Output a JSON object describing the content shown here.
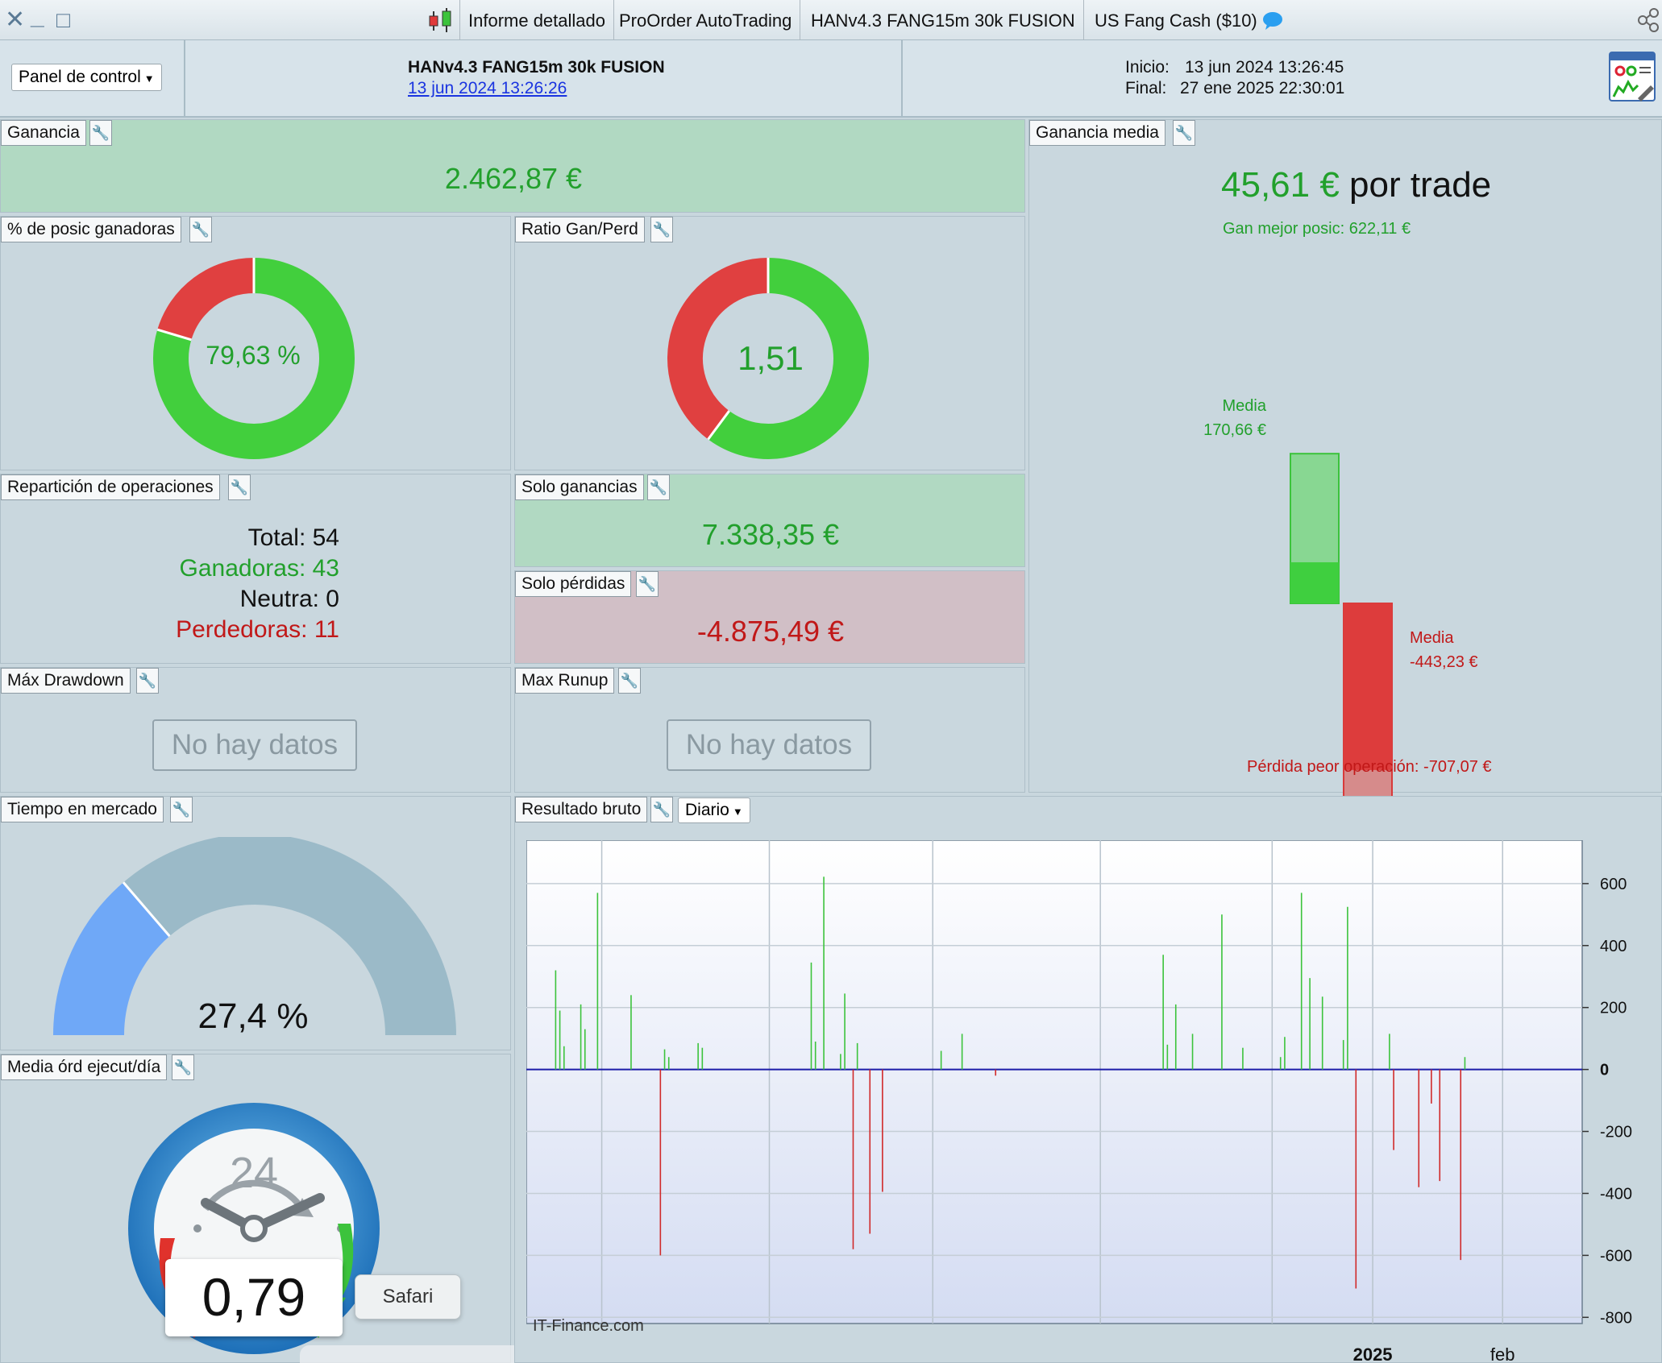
{
  "window": {
    "close_glyph": "✕",
    "minimize_glyph": "_",
    "maximize_glyph": "□",
    "tabs": [
      {
        "label": "Informe detallado",
        "icon": "candlestick-icon"
      },
      {
        "label": "ProOrder AutoTrading"
      },
      {
        "label": "HANv4.3 FANG15m 30k FUSION"
      },
      {
        "label": "US Fang Cash ($10)",
        "icon": "chat-bubble-icon"
      }
    ]
  },
  "header": {
    "panel_select": "Panel de control",
    "strategy_name": "HANv4.3 FANG15m 30k FUSION",
    "strategy_date": "13 jun 2024 13:26:26",
    "inicio_label": "Inicio:",
    "inicio_value": "13 jun 2024 13:26:45",
    "final_label": "Final:",
    "final_value": "27 ene 2025 22:30:01"
  },
  "ganancia": {
    "title": "Ganancia",
    "value": "2.462,87 €"
  },
  "pct_ganadoras": {
    "title": "% de posic ganadoras",
    "value": "79,63 %",
    "fraction": 0.7963
  },
  "ratio": {
    "title": "Ratio Gan/Perd",
    "value": "1,51",
    "fraction": 0.6016
  },
  "reparticion": {
    "title": "Repartición de operaciones",
    "total": "Total: 54",
    "ganadoras": "Ganadoras: 43",
    "neutra": "Neutra: 0",
    "perdedoras": "Perdedoras: 11"
  },
  "solo_ganancias": {
    "title": "Solo ganancias",
    "value": "7.338,35 €"
  },
  "solo_perdidas": {
    "title": "Solo pérdidas",
    "value": "-4.875,49 €"
  },
  "max_drawdown": {
    "title": "Máx Drawdown",
    "value": "No hay datos"
  },
  "max_runup": {
    "title": "Max Runup",
    "value": "No hay datos"
  },
  "ganancia_media": {
    "title": "Ganancia media",
    "value": "45,61 €",
    "suffix": "por trade",
    "best_label": "Gan mejor posic: 622,11 €",
    "win_media_label": "Media",
    "win_media_value": "170,66 €",
    "loss_media_label": "Media",
    "loss_media_value": "-443,23 €",
    "worst_label": "Pérdida peor operación: -707,07 €",
    "best_win": 622.11,
    "avg_win": 170.66,
    "avg_loss": -443.23,
    "worst_loss": -707.07
  },
  "tiempo_mercado": {
    "title": "Tiempo en mercado",
    "value": "27,4 %",
    "fraction": 0.274
  },
  "media_ordenes": {
    "title": "Media órd ejecut/día",
    "value": "0,79",
    "clock_label": "24"
  },
  "resultado_bruto": {
    "title": "Resultado bruto",
    "period": "Diario",
    "watermark": "IT-Finance.com"
  },
  "tooltip": {
    "label": "Safari"
  },
  "colors": {
    "green": "#22a02c",
    "red": "#c11818",
    "donut_green": "#42cf3d",
    "donut_red": "#e04040"
  },
  "chart_data": {
    "type": "bar",
    "title": "",
    "ylim": [
      -820,
      740
    ],
    "yticks": [
      600,
      400,
      200,
      0,
      -200,
      -400,
      -600,
      -800
    ],
    "ytick_labels": [
      "600",
      "400",
      "200",
      "0",
      "-200",
      "-400",
      "-600",
      "-800"
    ],
    "x_range": [
      "2024-06-13",
      "2025-02-20"
    ],
    "xtick_labels": [
      {
        "date": "2025-01-01",
        "label": "2025",
        "bold": true
      },
      {
        "date": "2025-02-01",
        "label": "feb",
        "bold": false
      }
    ],
    "grid": true,
    "series": [
      {
        "values": [
          {
            "x": "2024-06-20",
            "y": 320
          },
          {
            "x": "2024-06-21",
            "y": 190
          },
          {
            "x": "2024-06-22",
            "y": 75
          },
          {
            "x": "2024-06-26",
            "y": 210
          },
          {
            "x": "2024-06-27",
            "y": 130
          },
          {
            "x": "2024-06-30",
            "y": 570
          },
          {
            "x": "2024-07-08",
            "y": 240
          },
          {
            "x": "2024-07-15",
            "y": -600
          },
          {
            "x": "2024-07-16",
            "y": 65
          },
          {
            "x": "2024-07-17",
            "y": 40
          },
          {
            "x": "2024-07-24",
            "y": 85
          },
          {
            "x": "2024-07-25",
            "y": 70
          },
          {
            "x": "2024-08-20",
            "y": 345
          },
          {
            "x": "2024-08-21",
            "y": 90
          },
          {
            "x": "2024-08-23",
            "y": 622
          },
          {
            "x": "2024-08-27",
            "y": 50
          },
          {
            "x": "2024-08-28",
            "y": 245
          },
          {
            "x": "2024-08-30",
            "y": -580
          },
          {
            "x": "2024-08-31",
            "y": 85
          },
          {
            "x": "2024-09-03",
            "y": -530
          },
          {
            "x": "2024-09-06",
            "y": -395
          },
          {
            "x": "2024-09-20",
            "y": 60
          },
          {
            "x": "2024-09-25",
            "y": 115
          },
          {
            "x": "2024-10-03",
            "y": -20
          },
          {
            "x": "2024-11-12",
            "y": 370
          },
          {
            "x": "2024-11-13",
            "y": 80
          },
          {
            "x": "2024-11-15",
            "y": 210
          },
          {
            "x": "2024-11-19",
            "y": 115
          },
          {
            "x": "2024-11-26",
            "y": 500
          },
          {
            "x": "2024-12-01",
            "y": 70
          },
          {
            "x": "2024-12-10",
            "y": 40
          },
          {
            "x": "2024-12-11",
            "y": 105
          },
          {
            "x": "2024-12-15",
            "y": 570
          },
          {
            "x": "2024-12-17",
            "y": 295
          },
          {
            "x": "2024-12-20",
            "y": 235
          },
          {
            "x": "2024-12-25",
            "y": 95
          },
          {
            "x": "2024-12-26",
            "y": 525
          },
          {
            "x": "2024-12-28",
            "y": -707
          },
          {
            "x": "2025-01-05",
            "y": 115
          },
          {
            "x": "2025-01-06",
            "y": -260
          },
          {
            "x": "2025-01-12",
            "y": -380
          },
          {
            "x": "2025-01-15",
            "y": -110
          },
          {
            "x": "2025-01-17",
            "y": -360
          },
          {
            "x": "2025-01-22",
            "y": -615
          },
          {
            "x": "2025-01-23",
            "y": 40
          }
        ]
      }
    ]
  }
}
